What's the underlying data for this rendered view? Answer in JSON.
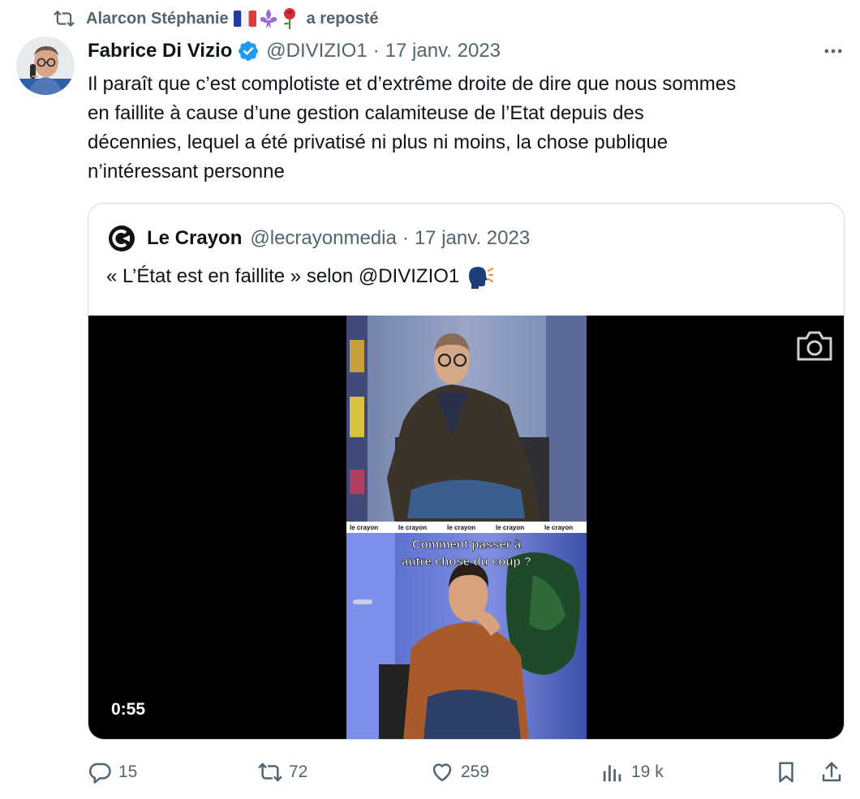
{
  "repost": {
    "user": "Alarcon Stéphanie",
    "action": "a reposté",
    "icon": "repost-icon",
    "flags": [
      "france-flag",
      "fleur-de-lis",
      "rose"
    ]
  },
  "tweet": {
    "author_name": "Fabrice Di Vizio",
    "handle": "@DIVIZIO1",
    "separator": "·",
    "date": "17 janv. 2023",
    "verified_color": "#1d9bf0",
    "text": "Il paraît que c’est complotiste et d’extrême droite de dire que nous sommes\nen faillite à cause d’une gestion calamiteuse de l’Etat depuis des\ndécennies, lequel a été privatisé ni plus ni moins, la chose publique\nn’intéressant personne"
  },
  "quote": {
    "author_name": "Le Crayon",
    "handle": "@lecrayonmedia",
    "separator": "·",
    "date": "17 janv. 2023",
    "text": "« L’État est en faillite » selon @DIVIZIO1",
    "emoji": "speaking-head",
    "video": {
      "duration": "0:55",
      "caption_line1": "Comment passer à",
      "caption_line2": "autre chose du coup ?",
      "banner": "le crayon"
    }
  },
  "actions": {
    "replies": "15",
    "reposts": "72",
    "likes": "259",
    "views": "19 k"
  },
  "colors": {
    "text": "#0f1419",
    "secondary": "#536471",
    "border": "#cfd9de",
    "accent": "#1d9bf0"
  }
}
